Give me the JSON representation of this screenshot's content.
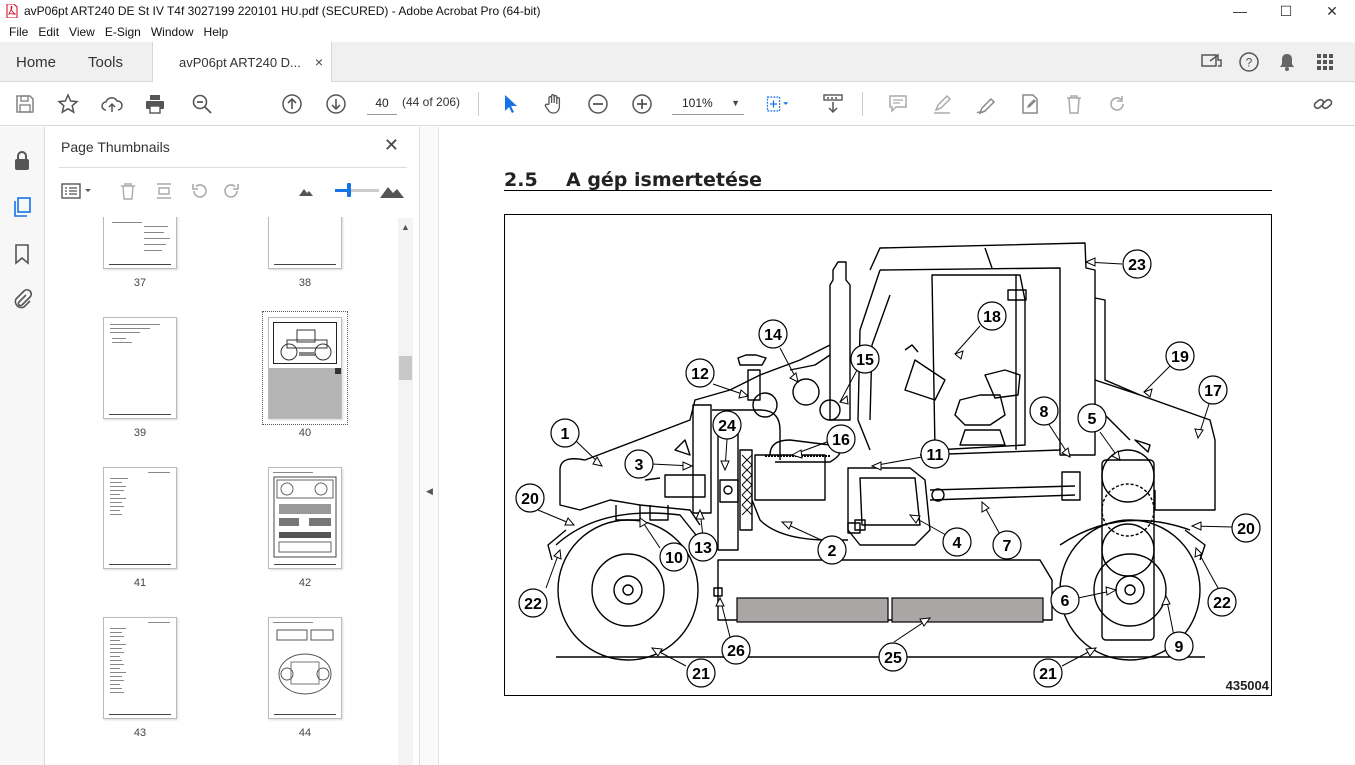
{
  "window": {
    "title": "avP06pt ART240 DE St IV T4f 3027199 220101 HU.pdf (SECURED) - Adobe Acrobat Pro (64-bit)",
    "minimize": "—",
    "maximize": "☐",
    "close": "✕"
  },
  "menu": [
    "File",
    "Edit",
    "View",
    "E-Sign",
    "Window",
    "Help"
  ],
  "tabs": {
    "home": "Home",
    "tools": "Tools",
    "document": "avP06pt ART240 D...",
    "close": "×"
  },
  "toolbar": {
    "page_current": "40",
    "page_count": "(44 of 206)",
    "zoom": "101%"
  },
  "thumbnails": {
    "panel_title": "Page Thumbnails",
    "pages": [
      "37",
      "38",
      "39",
      "40",
      "41",
      "42",
      "43",
      "44"
    ],
    "selected": "40"
  },
  "document": {
    "section_number": "2.5",
    "section_title": "A gép ismertetése",
    "figure_id": "435004",
    "callouts": [
      "1",
      "2",
      "3",
      "4",
      "5",
      "6",
      "7",
      "8",
      "9",
      "10",
      "11",
      "12",
      "13",
      "14",
      "15",
      "16",
      "17",
      "18",
      "19",
      "20",
      "20",
      "21",
      "21",
      "22",
      "22",
      "23",
      "24",
      "25",
      "26"
    ]
  },
  "colors": {
    "accent": "#1473e6",
    "selected_thumb_bg": "#b4b4b4",
    "figure_fill": "#aaa6a6"
  }
}
